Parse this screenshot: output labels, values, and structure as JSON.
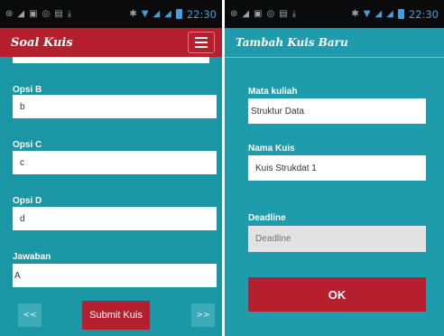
{
  "status_bar": {
    "time": "22:30"
  },
  "left_screen": {
    "app_title": "Soal Kuis",
    "fields": [
      {
        "label": "Opsi B",
        "value": "b"
      },
      {
        "label": "Opsi C",
        "value": "c"
      },
      {
        "label": "Opsi D",
        "value": "d"
      },
      {
        "label": "Jawaban",
        "value": "A"
      }
    ],
    "prev_label": "<<",
    "submit_label": "Submit Kuis",
    "next_label": ">>"
  },
  "right_screen": {
    "panel_title": "Tambah Kuis Baru",
    "fields": [
      {
        "label": "Mata kuliah",
        "value": "Struktur Data"
      },
      {
        "label": "Nama Kuis",
        "value": "Kuis Strukdat 1"
      },
      {
        "label": "Deadline",
        "value": "",
        "placeholder": "Deadline"
      }
    ],
    "ok_label": "OK"
  },
  "colors": {
    "teal": "#1b96a5",
    "red": "#b51f2e",
    "status_blue": "#3fa0e0"
  }
}
